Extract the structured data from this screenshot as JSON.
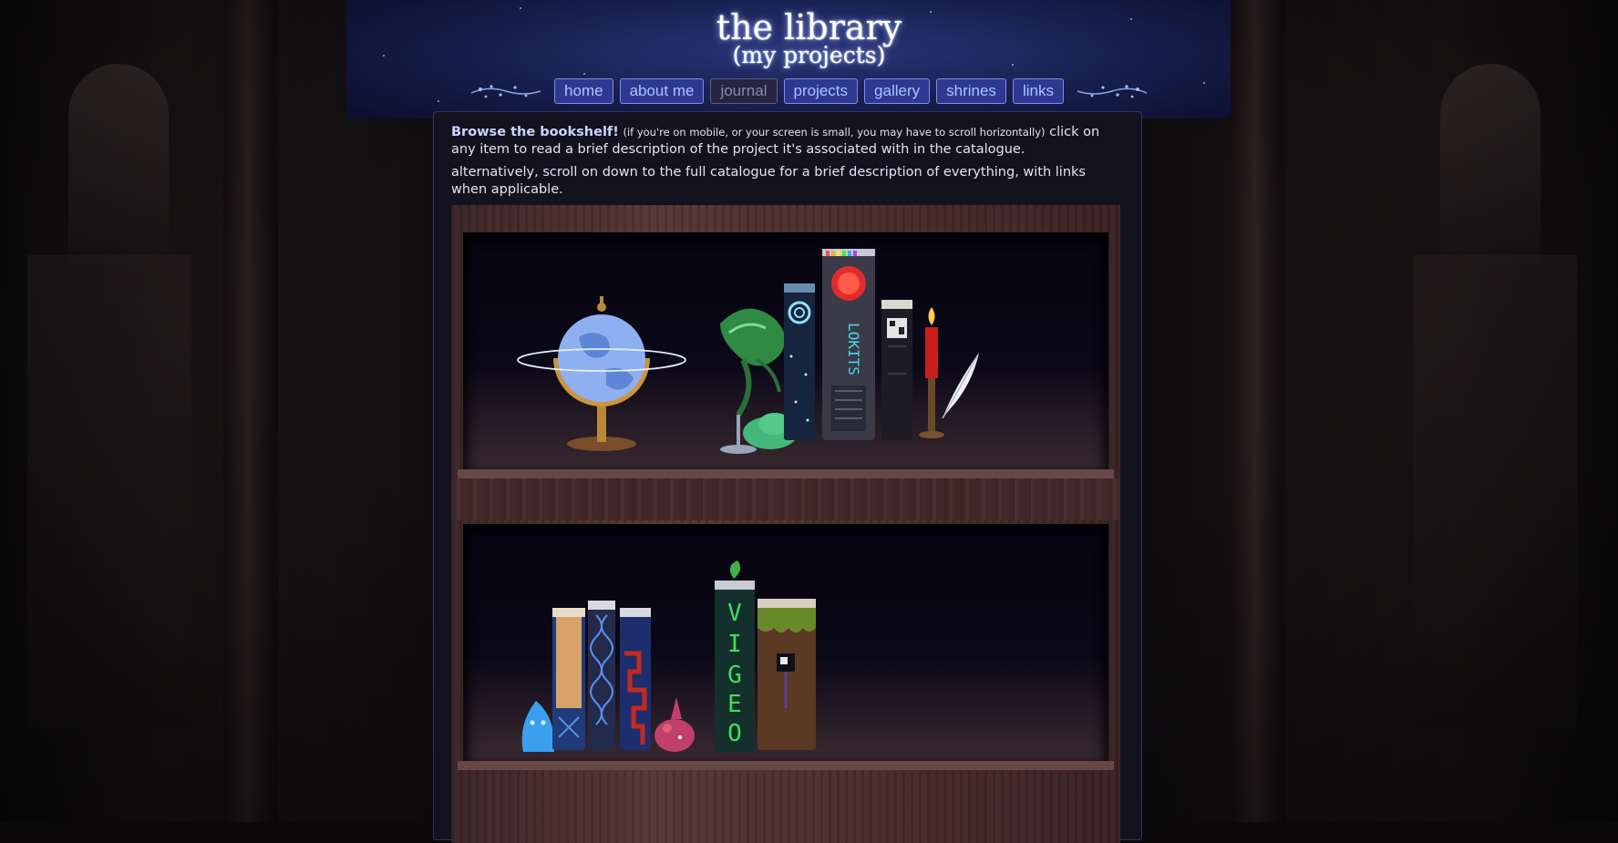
{
  "header": {
    "title": "the library",
    "subtitle": "(my projects)"
  },
  "nav": {
    "items": [
      {
        "label": "home",
        "state": "normal"
      },
      {
        "label": "about me",
        "state": "normal"
      },
      {
        "label": "journal",
        "state": "muted"
      },
      {
        "label": "projects",
        "state": "normal"
      },
      {
        "label": "gallery",
        "state": "normal"
      },
      {
        "label": "shrines",
        "state": "normal"
      },
      {
        "label": "links",
        "state": "normal"
      }
    ]
  },
  "intro": {
    "lead": "Browse the bookshelf!",
    "note": "(if you're on mobile, or your screen is small, you may have to scroll horizontally)",
    "rest": "click on any item to read a brief description of the project it's associated with in the catalogue.",
    "second": "alternatively, scroll on down to the full catalogue for a brief description of everything, with links when applicable."
  },
  "bookshelf": {
    "top_shelf": [
      "globe-icon",
      "plant-creature-icon",
      "spiral-book-icon",
      "lokits-book-icon",
      "qr-book-icon",
      "candle-icon",
      "quill-icon"
    ],
    "top_shelf_book_titles": {
      "lokits": "LOKITS"
    },
    "bottom_shelf": [
      "blue-slime-icon",
      "tan-book-icon",
      "dna-book-icon",
      "red-pattern-book-icon",
      "mouse-icon",
      "vigeo-book-icon",
      "grass-book-icon"
    ],
    "bottom_shelf_book_titles": {
      "vigeo": "VIGEO"
    }
  },
  "colors": {
    "nav_bg": "#2f3891",
    "nav_text": "#a9c4ff",
    "panel_bg": "#13121e",
    "shelf_wood": "#4a2c2c"
  }
}
